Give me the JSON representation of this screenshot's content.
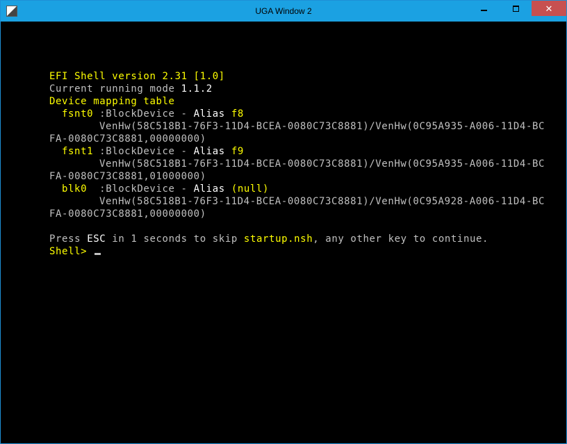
{
  "window": {
    "title": "UGA Window 2"
  },
  "shell": {
    "version_label": "EFI Shell version 2.31 [1.0]",
    "mode_label": "Current running mode ",
    "mode_value": "1.1.2",
    "mapping_header": "Device mapping table",
    "devices": [
      {
        "name": "fsnt0",
        "sep": " :BlockDevice - ",
        "alias_label": "Alias ",
        "alias_value": "f8",
        "path1": "VenHw(58C518B1-76F3-11D4-BCEA-0080C73C8881)/VenHw(0C95A935-A006-11D4-BC",
        "path2": "FA-0080C73C8881,00000000)"
      },
      {
        "name": "fsnt1",
        "sep": " :BlockDevice - ",
        "alias_label": "Alias ",
        "alias_value": "f9",
        "path1": "VenHw(58C518B1-76F3-11D4-BCEA-0080C73C8881)/VenHw(0C95A935-A006-11D4-BC",
        "path2": "FA-0080C73C8881,01000000)"
      },
      {
        "name": "blk0",
        "sep": "  :BlockDevice - ",
        "alias_label": "Alias ",
        "alias_value": "(null)",
        "path1": "VenHw(58C518B1-76F3-11D4-BCEA-0080C73C8881)/VenHw(0C95A928-A006-11D4-BC",
        "path2": "FA-0080C73C8881,00000000)"
      }
    ],
    "press": {
      "p1": "Press ",
      "esc": "ESC",
      "p2": " in 1 seconds to skip ",
      "file": "startup.nsh",
      "p3": ", any other key to continue."
    },
    "prompt": "Shell> "
  }
}
